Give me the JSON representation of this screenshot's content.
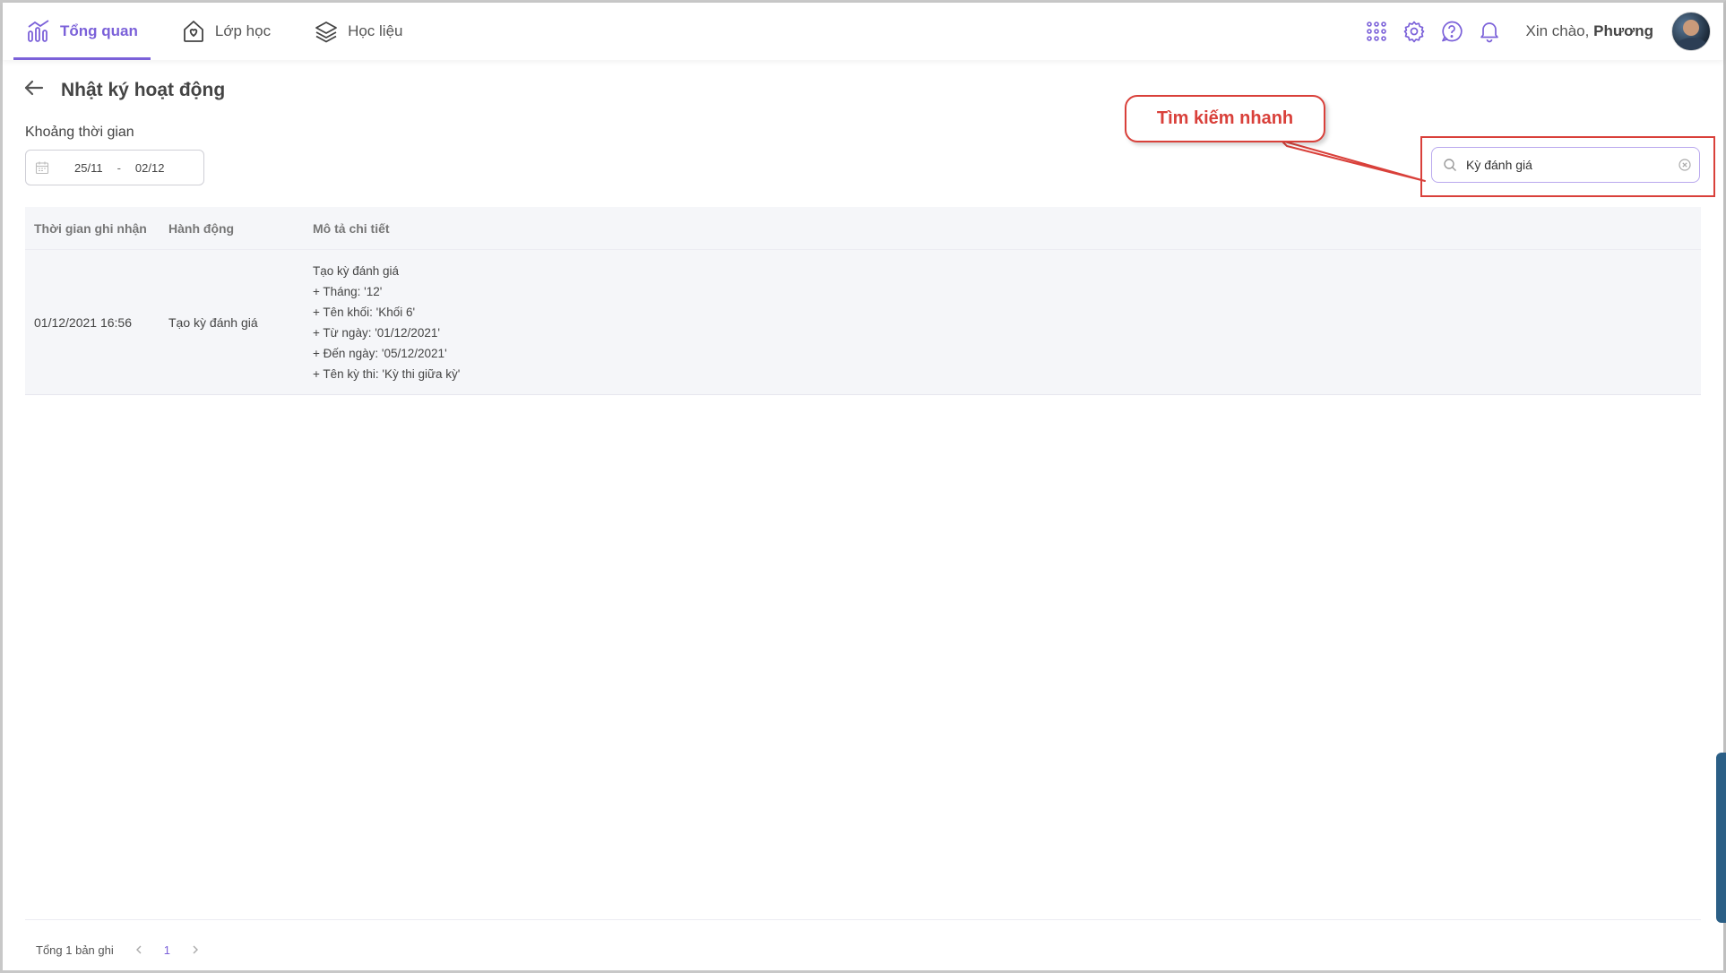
{
  "nav": {
    "items": [
      {
        "label": "Tổng quan",
        "icon": "chart-icon",
        "active": true
      },
      {
        "label": "Lớp học",
        "icon": "heart-house-icon",
        "active": false
      },
      {
        "label": "Học liệu",
        "icon": "layers-icon",
        "active": false
      }
    ]
  },
  "header": {
    "greeting_prefix": "Xin chào,",
    "user_name": "Phương"
  },
  "page": {
    "title": "Nhật ký hoạt động"
  },
  "filter": {
    "range_label": "Khoảng thời gian",
    "from": "25/11",
    "separator": "-",
    "to": "02/12"
  },
  "callout": {
    "text": "Tìm kiếm nhanh"
  },
  "search": {
    "value": "Kỳ đánh giá"
  },
  "table": {
    "headers": [
      "Thời gian ghi nhận",
      "Hành động",
      "Mô tả chi tiết"
    ],
    "rows": [
      {
        "time": "01/12/2021 16:56",
        "action": "Tạo kỳ đánh giá",
        "details": [
          "Tạo kỳ đánh giá",
          "+ Tháng: '12'",
          "+ Tên khối: 'Khối 6'",
          "+ Từ ngày: '01/12/2021'",
          "+ Đến ngày: '05/12/2021'",
          "+ Tên kỳ thi: 'Kỳ thi giữa kỳ'"
        ]
      }
    ]
  },
  "footer": {
    "total": "Tổng 1 bản ghi",
    "current_page": "1"
  },
  "colors": {
    "accent": "#7b61d9",
    "annotation": "#d9403a"
  }
}
